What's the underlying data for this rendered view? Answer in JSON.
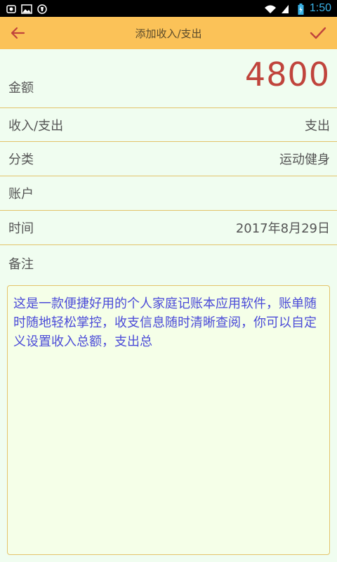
{
  "status_bar": {
    "time": "1:50",
    "icons": [
      "android-icon",
      "image-icon",
      "shield-icon",
      "wifi-icon",
      "signal-icon",
      "battery-icon"
    ]
  },
  "app_bar": {
    "title": "添加收入/支出",
    "back_icon": "arrow-left-icon",
    "confirm_icon": "check-icon",
    "background": "#fbc258"
  },
  "form": {
    "amount": {
      "label": "金额",
      "value": "4800"
    },
    "type": {
      "label": "收入/支出",
      "value": "支出"
    },
    "category": {
      "label": "分类",
      "value": "运动健身"
    },
    "account": {
      "label": "账户",
      "value": ""
    },
    "time": {
      "label": "时间",
      "value": "2017年8月29日"
    },
    "note": {
      "label": "备注",
      "value": "这是一款便捷好用的个人家庭记账本应用软件，账单随时随地轻松掌控，收支信息随时清晰查阅，你可以自定义设置收入总额，支出总"
    }
  },
  "colors": {
    "accent": "#fbc258",
    "amount": "#c0443c",
    "note_text": "#4b4bd8",
    "divider": "#e3c36a",
    "background": "#f0fdf0"
  }
}
